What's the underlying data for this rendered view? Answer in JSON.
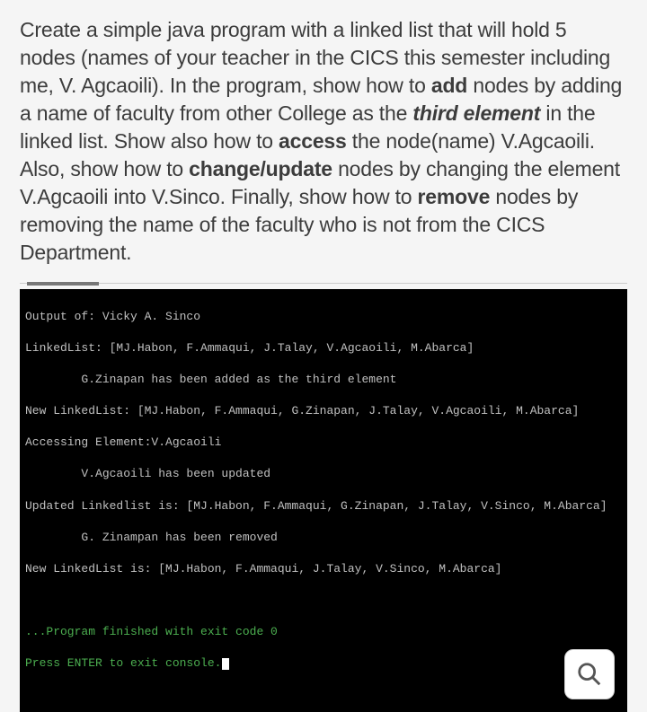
{
  "instructions": {
    "part1": "Create a simple java program with a linked list that will hold 5 nodes (names of your teacher in the CICS this semester including me, V. Agcaoili). In the program, show how to ",
    "add_bold": "add",
    "part2": " nodes by adding a name of faculty from other College as the ",
    "third_elem": "third element",
    "part3": " in the linked list. Show also how to ",
    "access_bold": "access",
    "part4": " the node(name) V.Agcaoili. Also, show how to ",
    "change_bold": "change/update",
    "part5": " nodes by changing the element V.Agcaoili into V.Sinco. Finally, show how to ",
    "remove_bold": "remove",
    "part6": " nodes by removing the name of the faculty who is not from the CICS Department."
  },
  "console": {
    "lines": [
      "Output of: Vicky A. Sinco",
      "LinkedList: [MJ.Habon, F.Ammaqui, J.Talay, V.Agcaoili, M.Abarca]",
      "        G.Zinapan has been added as the third element",
      "New LinkedList: [MJ.Habon, F.Ammaqui, G.Zinapan, J.Talay, V.Agcaoili, M.Abarca]",
      "Accessing Element:V.Agcaoili",
      "        V.Agcaoili has been updated",
      "Updated Linkedlist is: [MJ.Habon, F.Ammaqui, G.Zinapan, J.Talay, V.Sinco, M.Abarca]",
      "        G. Zinampan has been removed",
      "New LinkedList is: [MJ.Habon, F.Ammaqui, J.Talay, V.Sinco, M.Abarca]"
    ],
    "exit_line": "...Program finished with exit code 0",
    "press_enter": "Press ENTER to exit console."
  }
}
